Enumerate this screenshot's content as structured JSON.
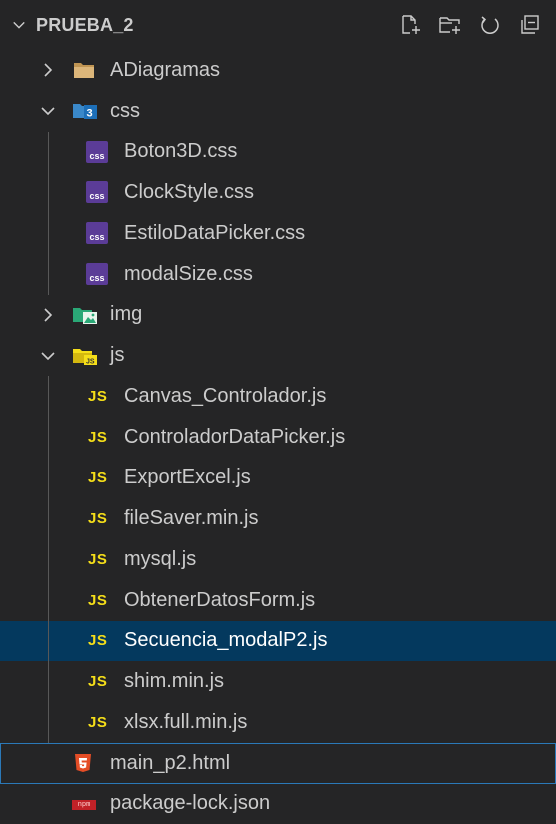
{
  "explorer": {
    "title": "PRUEBA_2",
    "actions": {
      "new_file_icon": "new-file-icon",
      "new_folder_icon": "new-folder-icon",
      "refresh_icon": "refresh-icon",
      "collapse_icon": "collapse-all-icon"
    }
  },
  "tree": {
    "items": [
      {
        "label": "ADiagramas",
        "type": "folder",
        "state": "collapsed",
        "icon": "folder-icon"
      },
      {
        "label": "css",
        "type": "folder",
        "state": "expanded",
        "icon": "css-folder-icon"
      },
      {
        "label": "Boton3D.css",
        "type": "css",
        "icon": "css-file-icon",
        "badge": "css"
      },
      {
        "label": "ClockStyle.css",
        "type": "css",
        "icon": "css-file-icon",
        "badge": "css"
      },
      {
        "label": "EstiloDataPicker.css",
        "type": "css",
        "icon": "css-file-icon",
        "badge": "css"
      },
      {
        "label": "modalSize.css",
        "type": "css",
        "icon": "css-file-icon",
        "badge": "css"
      },
      {
        "label": "img",
        "type": "folder",
        "state": "collapsed",
        "icon": "image-folder-icon"
      },
      {
        "label": "js",
        "type": "folder",
        "state": "expanded",
        "icon": "js-folder-icon"
      },
      {
        "label": "Canvas_Controlador.js",
        "type": "js",
        "icon": "js-file-icon",
        "badge": "JS"
      },
      {
        "label": "ControladorDataPicker.js",
        "type": "js",
        "icon": "js-file-icon",
        "badge": "JS"
      },
      {
        "label": "ExportExcel.js",
        "type": "js",
        "icon": "js-file-icon",
        "badge": "JS"
      },
      {
        "label": "fileSaver.min.js",
        "type": "js",
        "icon": "js-file-icon",
        "badge": "JS"
      },
      {
        "label": "mysql.js",
        "type": "js",
        "icon": "js-file-icon",
        "badge": "JS"
      },
      {
        "label": "ObtenerDatosForm.js",
        "type": "js",
        "icon": "js-file-icon",
        "badge": "JS"
      },
      {
        "label": "Secuencia_modalP2.js",
        "type": "js",
        "icon": "js-file-icon",
        "badge": "JS",
        "selected": true
      },
      {
        "label": "shim.min.js",
        "type": "js",
        "icon": "js-file-icon",
        "badge": "JS"
      },
      {
        "label": "xlsx.full.min.js",
        "type": "js",
        "icon": "js-file-icon",
        "badge": "JS"
      },
      {
        "label": "main_p2.html",
        "type": "html",
        "icon": "html5-file-icon",
        "focused": true
      },
      {
        "label": "package-lock.json",
        "type": "npm",
        "icon": "npm-file-icon",
        "badge": "npm"
      }
    ]
  },
  "colors": {
    "background": "#252526",
    "selected_bg": "#04395e",
    "focus_border": "#2b79b8",
    "js_yellow": "#f5de19",
    "css_purple": "#5b3c97",
    "html_orange": "#e44d26",
    "folder_tan": "#c09553",
    "npm_red": "#c12127"
  }
}
